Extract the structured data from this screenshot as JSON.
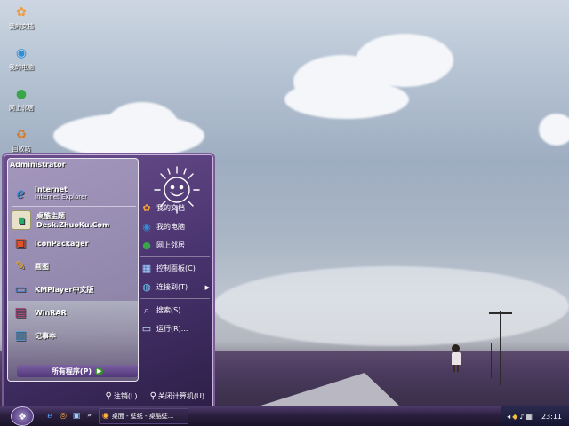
{
  "desktop": {
    "icons": [
      {
        "label": "我的文档",
        "icon": "my-documents-icon"
      },
      {
        "label": "我的电脑",
        "icon": "my-computer-icon"
      },
      {
        "label": "网上邻居",
        "icon": "network-places-icon"
      },
      {
        "label": "回收站",
        "icon": "recycle-bin-icon"
      }
    ]
  },
  "start_menu": {
    "user": "Administrator",
    "pinned": [
      {
        "name": "Internet",
        "sub": "Internet Explorer",
        "icon": "internet-explorer-icon"
      }
    ],
    "recent": [
      {
        "name": "桌酷主题Desk.ZhuoKu.Com",
        "icon": "theme-app-icon"
      },
      {
        "name": "IconPackager",
        "icon": "iconpackager-icon"
      },
      {
        "name": "画图",
        "icon": "paint-icon"
      },
      {
        "name": "KMPlayer中文版",
        "icon": "kmplayer-icon"
      },
      {
        "name": "WinRAR",
        "icon": "winrar-icon"
      },
      {
        "name": "记事本",
        "icon": "notepad-icon"
      }
    ],
    "all_programs": "所有程序(P)",
    "right_items": [
      {
        "label": "我的文档",
        "icon": "my-documents-icon",
        "arrow": false
      },
      {
        "label": "我的电脑",
        "icon": "my-computer-icon",
        "arrow": false
      },
      {
        "label": "网上邻居",
        "icon": "network-places-icon",
        "arrow": false
      },
      {
        "label": "控制面板(C)",
        "icon": "control-panel-icon",
        "arrow": false
      },
      {
        "label": "连接到(T)",
        "icon": "connect-to-icon",
        "arrow": true
      },
      {
        "label": "搜索(S)",
        "icon": "search-icon",
        "arrow": false
      },
      {
        "label": "运行(R)...",
        "icon": "run-icon",
        "arrow": false
      }
    ],
    "logoff": "注销(L)",
    "shutdown": "关闭计算机(U)"
  },
  "taskbar": {
    "task_label": "桌面 - 壁纸 - 桌酷壁...",
    "clock": "23:11",
    "quick_launch_more": "»"
  },
  "colors": {
    "accent": "#6b4f8d",
    "taskbar": "#2a1f3f"
  }
}
